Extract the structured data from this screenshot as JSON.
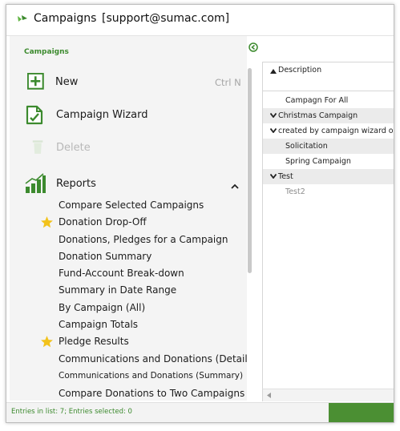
{
  "window": {
    "title": "Campaigns",
    "account": "[support@sumac.com]"
  },
  "left_panel": {
    "section_title": "Campaigns",
    "actions": [
      {
        "label": "New",
        "shortcut": "Ctrl N",
        "icon": "plus-box-icon",
        "enabled": true
      },
      {
        "label": "Campaign Wizard",
        "icon": "wizard-document-icon",
        "enabled": true
      },
      {
        "label": "Delete",
        "icon": "trash-icon",
        "enabled": false
      }
    ],
    "reports": {
      "label": "Reports",
      "icon": "bar-chart-icon",
      "items": [
        {
          "label": "Compare Selected Campaigns",
          "starred": false
        },
        {
          "label": "Donation Drop-Off",
          "starred": true
        },
        {
          "label": "Donations, Pledges for a Campaign",
          "starred": false
        },
        {
          "label": "Donation Summary",
          "starred": false
        },
        {
          "label": "Fund-Account Break-down",
          "starred": false
        },
        {
          "label": "Summary in Date Range",
          "starred": false
        },
        {
          "label": "By Campaign (All)",
          "starred": false
        },
        {
          "label": "Campaign Totals",
          "starred": false
        },
        {
          "label": "Pledge Results",
          "starred": true
        },
        {
          "label": "Communications and Donations (Detail)",
          "starred": false
        },
        {
          "label": "Communications and Donations (Summary)",
          "starred": false
        },
        {
          "label": "Compare Donations to Two Campaigns",
          "starred": false
        }
      ]
    }
  },
  "list": {
    "column_header": "Description",
    "rows": [
      {
        "label": "Campagn For All",
        "type": "item"
      },
      {
        "label": "Christmas Campaign",
        "type": "group"
      },
      {
        "label": "created by campaign wizard on",
        "type": "group"
      },
      {
        "label": "Solicitation",
        "type": "item"
      },
      {
        "label": "Spring Campaign",
        "type": "item"
      },
      {
        "label": "Test",
        "type": "group"
      },
      {
        "label": "Test2",
        "type": "item"
      }
    ]
  },
  "status": {
    "text": "Entries in list: 7; Entries selected: 0"
  },
  "colors": {
    "accent_green": "#3c8a2e",
    "star": "#f2c21b",
    "group_row": "#ebebeb"
  }
}
